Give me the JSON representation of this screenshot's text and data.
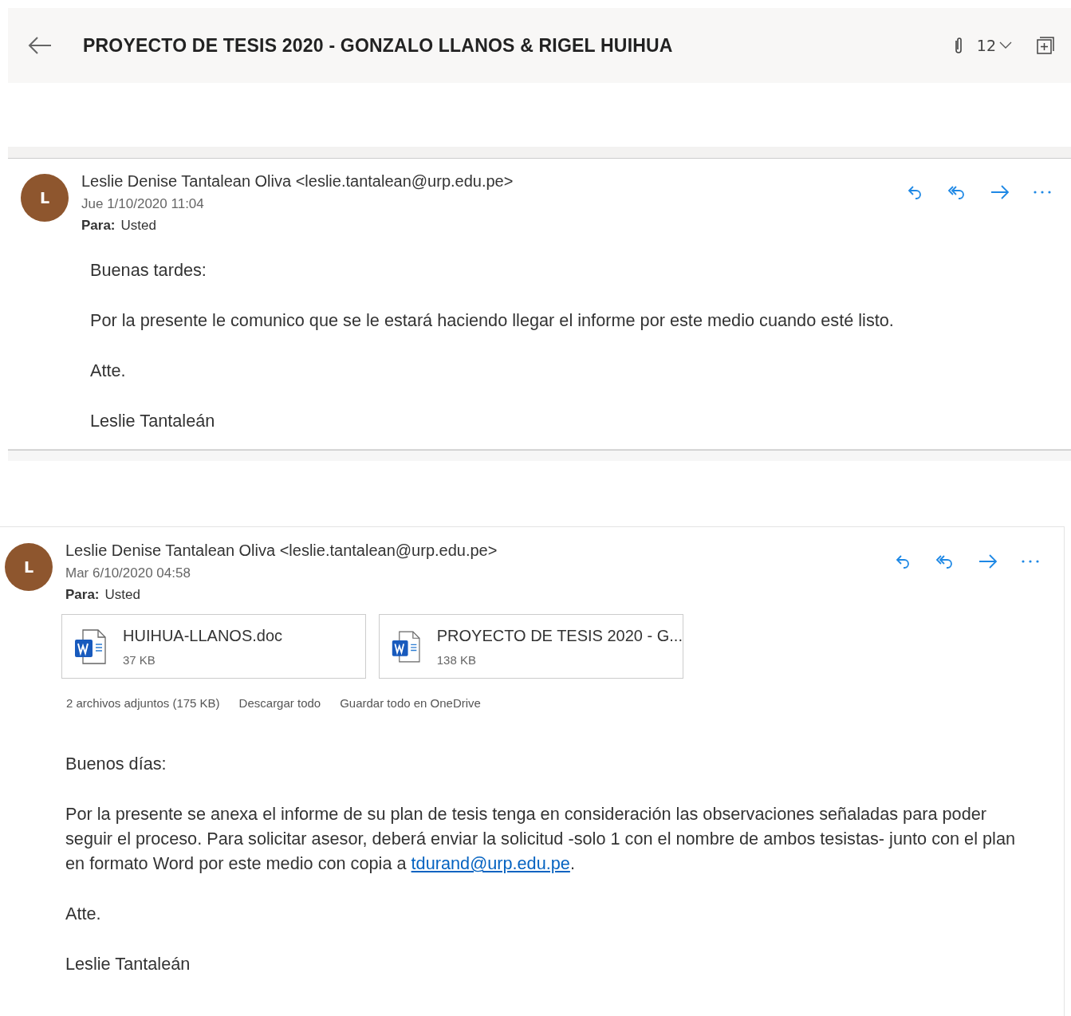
{
  "header": {
    "title": "PROYECTO DE TESIS 2020 - GONZALO LLANOS & RIGEL HUIHUA",
    "attachment_count": "12"
  },
  "messages": [
    {
      "initial": "L",
      "sender": "Leslie Denise Tantalean Oliva <leslie.tantalean@urp.edu.pe>",
      "date": "Jue 1/10/2020 11:04",
      "to_label": "Para:",
      "to": "Usted",
      "body": [
        {
          "text": "Buenas tardes:"
        },
        {
          "text": "Por la presente le comunico que se le estará haciendo llegar el informe por este medio cuando esté listo."
        },
        {
          "text": "Atte."
        },
        {
          "text": "Leslie Tantaleán"
        }
      ]
    },
    {
      "initial": "L",
      "sender": "Leslie Denise Tantalean Oliva <leslie.tantalean@urp.edu.pe>",
      "date": "Mar 6/10/2020 04:58",
      "to_label": "Para:",
      "to": "Usted",
      "attachments": [
        {
          "name": "HUIHUA-LLANOS.doc",
          "size": "37 KB"
        },
        {
          "name": "PROYECTO DE TESIS 2020 - G...",
          "size": "138 KB"
        }
      ],
      "attachment_summary": {
        "count": "2 archivos adjuntos (175 KB)",
        "download": "Descargar todo",
        "save": "Guardar todo en OneDrive"
      },
      "body": [
        {
          "text": "Buenos días:"
        },
        {
          "text": "Por la presente se anexa el informe de su plan de tesis tenga en consideración las observaciones señaladas para poder seguir el proceso. Para solicitar asesor, deberá enviar la solicitud -solo 1 con el nombre de ambos tesistas- junto con el plan en formato Word por este medio con copia a ",
          "link": "tdurand@urp.edu.pe",
          "after": "."
        },
        {
          "text": "Atte."
        },
        {
          "text": "Leslie Tantaleán"
        }
      ]
    }
  ]
}
